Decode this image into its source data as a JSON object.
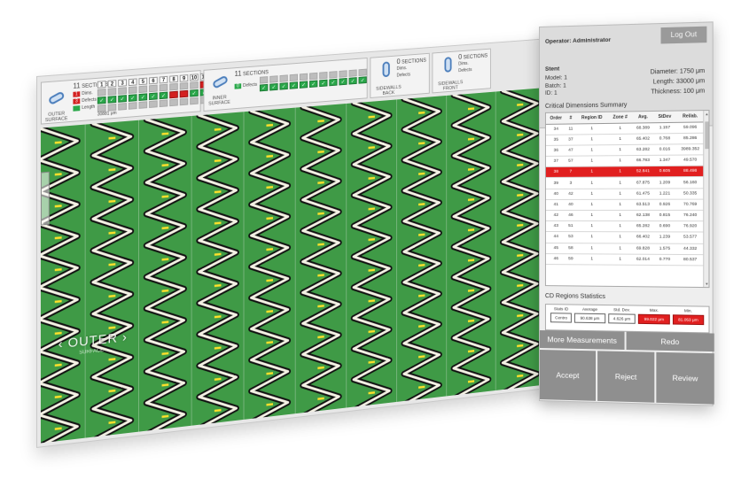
{
  "toolbar": {
    "outer": {
      "sections_count": "11",
      "sections_word": "SECTIONS",
      "label_line1": "OUTER",
      "label_line2": "SURFACE",
      "dims_count": "1",
      "dims_label": "Dims.",
      "defects_count": "3",
      "defects_label": "Defects",
      "length_label": "Length",
      "length_value": "30881 μm",
      "columns": [
        "1",
        "2",
        "3",
        "4",
        "5",
        "6",
        "7",
        "8",
        "9",
        "10",
        "11"
      ],
      "row1": [
        "grey",
        "grey",
        "grey",
        "grey",
        "grey",
        "grey",
        "grey",
        "grey",
        "grey",
        "grey",
        "bad"
      ],
      "row2": [
        "ok",
        "ok",
        "ok",
        "ok",
        "ok",
        "ok",
        "ok",
        "bad",
        "bad",
        "ok",
        "ok"
      ],
      "row3": [
        "grey",
        "grey",
        "grey",
        "grey",
        "grey",
        "grey",
        "grey",
        "grey",
        "grey",
        "grey",
        "grey"
      ]
    },
    "inner": {
      "sections_count": "11",
      "sections_word": "SECTIONS",
      "label_line1": "INNER",
      "label_line2": "SURFACE",
      "defects_count": "0",
      "defects_label": "Defects",
      "row1": [
        "grey",
        "grey",
        "grey",
        "grey",
        "grey",
        "grey",
        "grey",
        "grey",
        "grey",
        "grey",
        "grey"
      ],
      "row2": [
        "ok",
        "ok",
        "ok",
        "ok",
        "ok",
        "ok",
        "ok",
        "ok",
        "ok",
        "ok",
        "ok"
      ]
    },
    "back": {
      "sections_count": "0",
      "sections_word": "SECTIONS",
      "label_line1": "SIDEWALLS",
      "label_line2": "BACK",
      "dims_label": "Dims.",
      "defects_label": "Defects"
    },
    "front": {
      "sections_count": "0",
      "sections_word": "SECTIONS",
      "label_line1": "SIDEWALLS",
      "label_line2": "FRONT",
      "dims_label": "Dims.",
      "defects_label": "Defects"
    }
  },
  "image": {
    "overlay_label": "‹ OUTER ›",
    "overlay_sub": "SURFACE"
  },
  "panel": {
    "operator": "Operator: Administrator",
    "logout": "Log Out",
    "stent_title": "Stent",
    "model": "Model: 1",
    "batch": "Batch: 1",
    "id": "ID: 1",
    "diameter": "Diameter: 1750 μm",
    "length": "Length: 33000 μm",
    "thickness": "Thickness: 100 μm",
    "cd_title": "Critical Dimensions Summary",
    "cd_headers": [
      "Order",
      "#",
      "Region ID",
      "Zone #",
      "Avg.",
      "StDev",
      "Rel/ab."
    ],
    "cd_rows": [
      [
        "34",
        "11",
        "1",
        "1",
        "68.389",
        "1.157",
        "59.096"
      ],
      [
        "35",
        "37",
        "1",
        "1",
        "65.402",
        "0.768",
        "85.286"
      ],
      [
        "36",
        "47",
        "1",
        "1",
        "63.282",
        "0.016",
        "3989.352"
      ],
      [
        "37",
        "57",
        "1",
        "1",
        "66.783",
        "1.347",
        "49.570"
      ],
      [
        "38",
        "7",
        "1",
        "1",
        "52.841",
        "0.605",
        "88.498"
      ],
      [
        "39",
        "3",
        "1",
        "1",
        "67.875",
        "1.209",
        "56.160"
      ],
      [
        "40",
        "42",
        "1",
        "1",
        "61.475",
        "1.221",
        "50.335"
      ],
      [
        "41",
        "40",
        "1",
        "1",
        "63.513",
        "0.926",
        "70.769"
      ],
      [
        "42",
        "46",
        "1",
        "1",
        "62.138",
        "0.815",
        "76.240"
      ],
      [
        "43",
        "51",
        "1",
        "1",
        "65.282",
        "0.690",
        "76.920"
      ],
      [
        "44",
        "53",
        "1",
        "1",
        "66.402",
        "1.239",
        "53.577"
      ],
      [
        "45",
        "58",
        "1",
        "1",
        "69.828",
        "1.575",
        "44.332"
      ],
      [
        "46",
        "59",
        "1",
        "1",
        "62.014",
        "0.770",
        "80.537"
      ]
    ],
    "cd_highlight_row": 4,
    "stats_title": "CD Regions Statistics",
    "stats_headers": [
      "Stats ID",
      "Average",
      "Std. Dev.",
      "Max.",
      "Min."
    ],
    "stats_row": [
      "Centro",
      "90.638 μm",
      "4.626 μm",
      "99.022 μm",
      "81.053 μm"
    ],
    "more_measurements": "More Measurements",
    "redo": "Redo",
    "accept": "Accept",
    "reject": "Reject",
    "review": "Review"
  },
  "colors": {
    "background_green": "#3f9a46",
    "strut_outline": "#111111",
    "strut_fill": "#f4f1e4",
    "marker_yellow": "#ffe12a",
    "highlight_red": "#e11f1f",
    "ok_green": "#2aa84a",
    "button_grey": "#8f8f8f"
  },
  "icons": {
    "stent": "stent-icon",
    "check": "check-icon"
  }
}
